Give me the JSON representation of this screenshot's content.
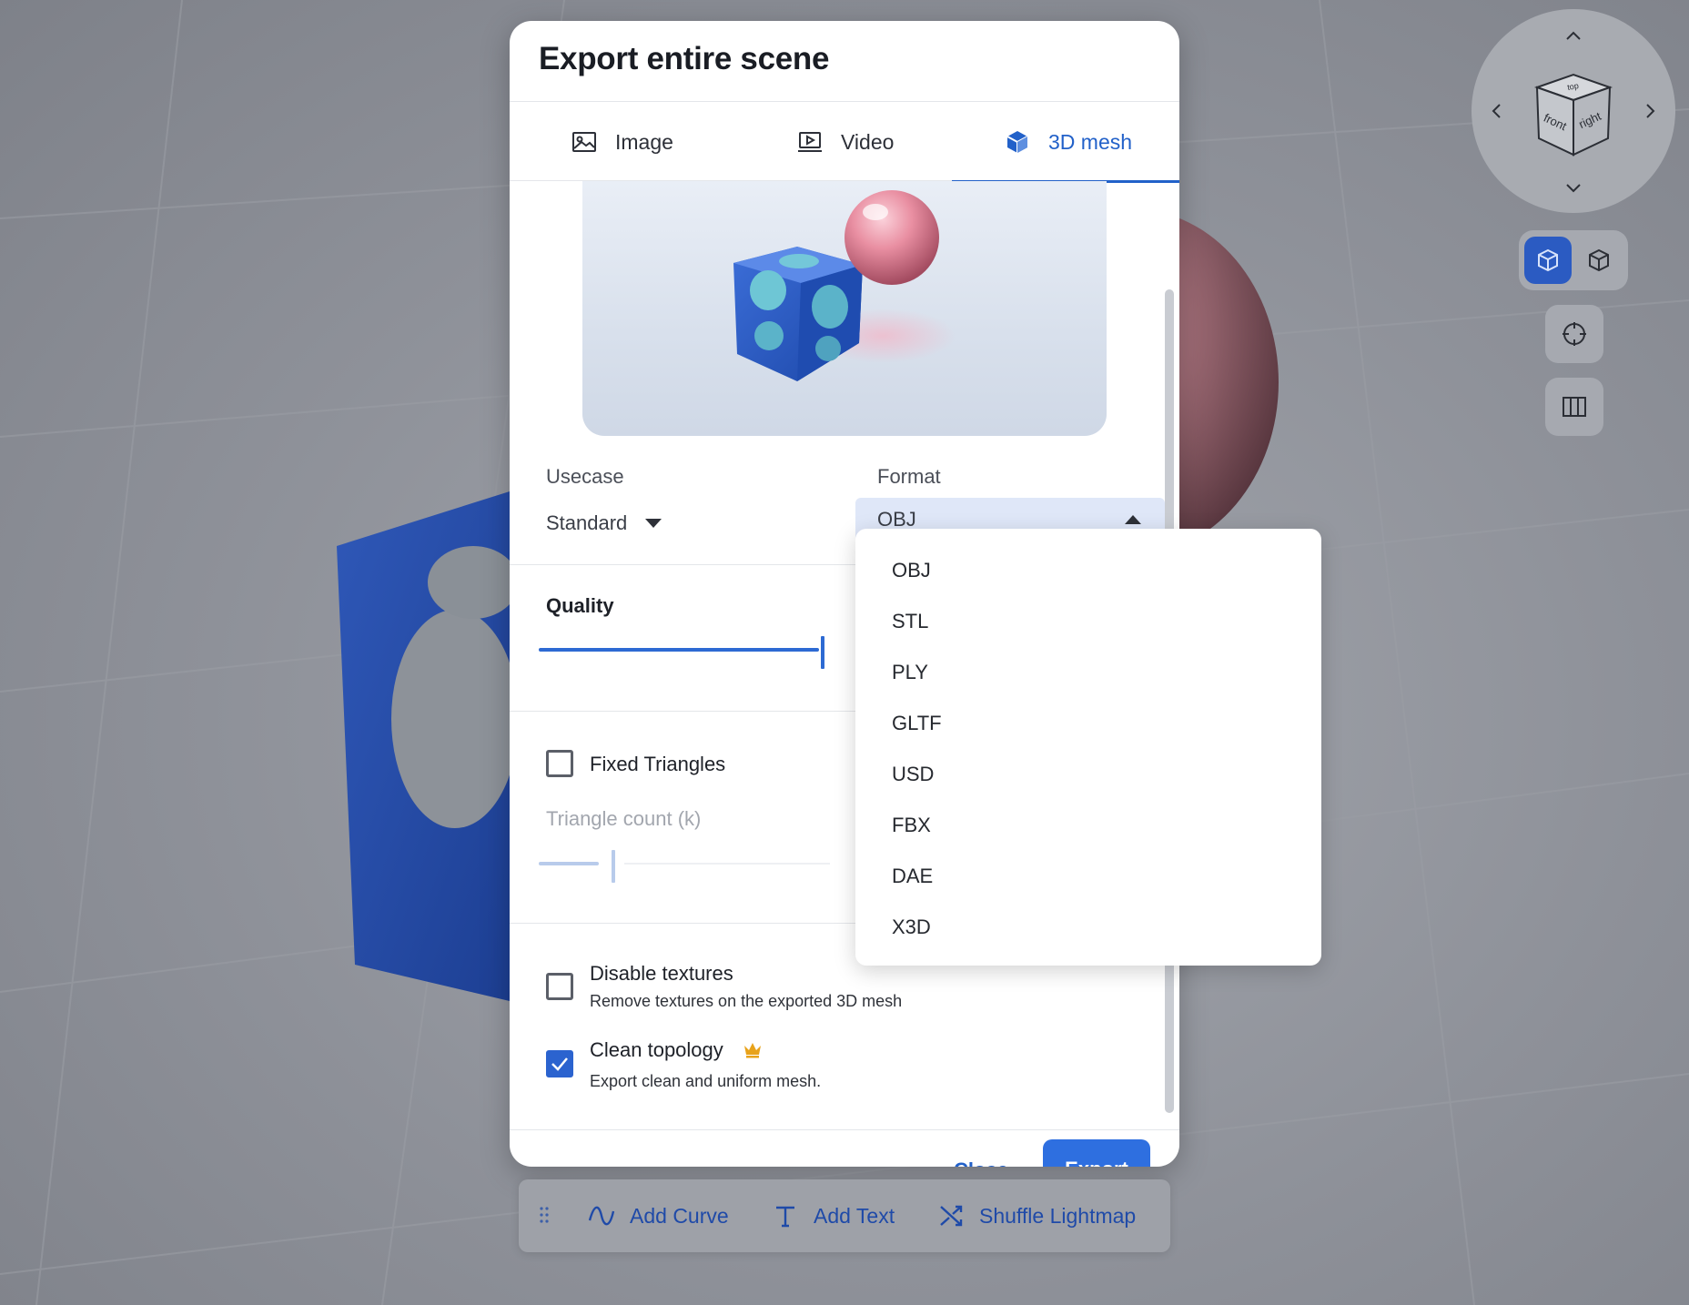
{
  "dialog": {
    "title": "Export entire scene",
    "tabs": [
      {
        "label": "Image",
        "icon": "image-icon",
        "active": false
      },
      {
        "label": "Video",
        "icon": "video-icon",
        "active": false
      },
      {
        "label": "3D mesh",
        "icon": "cube-icon",
        "active": true
      }
    ],
    "usecase": {
      "label": "Usecase",
      "value": "Standard"
    },
    "format": {
      "label": "Format",
      "value": "OBJ"
    },
    "quality": {
      "label": "Quality",
      "level": 1.0
    },
    "fixed_triangles": {
      "label": "Fixed Triangles",
      "checked": false
    },
    "triangle_count": {
      "label": "Triangle count (k)",
      "level": 0.25
    },
    "disable_textures": {
      "label": "Disable textures",
      "description": "Remove textures on the exported 3D mesh",
      "checked": false
    },
    "clean_topology": {
      "label": "Clean topology",
      "description": "Export clean and uniform mesh.",
      "checked": true,
      "badge_icon": "crown-icon"
    },
    "footer": {
      "close_label": "Close",
      "export_label": "Export"
    }
  },
  "format_menu": {
    "options": [
      "OBJ",
      "STL",
      "PLY",
      "GLTF",
      "USD",
      "FBX",
      "DAE",
      "X3D"
    ]
  },
  "toolbar": {
    "items": [
      {
        "label": "Add Curve",
        "icon": "curve-icon"
      },
      {
        "label": "Add Text",
        "icon": "text-icon"
      },
      {
        "label": "Shuffle Lightmap",
        "icon": "shuffle-icon"
      }
    ]
  },
  "navcube": {
    "face_front": "front",
    "face_right": "right",
    "face_top": "top"
  },
  "colors": {
    "accent": "#2261c9",
    "checkbox_checked": "#2b63cf",
    "format_select_bg": "#dfe7f8",
    "crown": "#e8a21a"
  }
}
